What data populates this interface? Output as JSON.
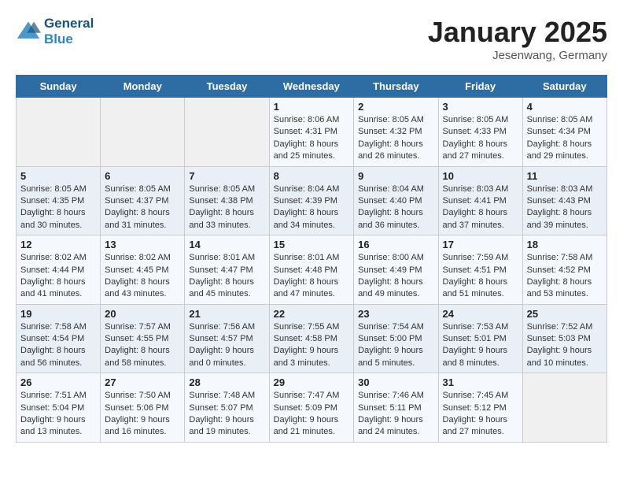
{
  "header": {
    "logo_line1": "General",
    "logo_line2": "Blue",
    "month": "January 2025",
    "location": "Jesenwang, Germany"
  },
  "columns": [
    "Sunday",
    "Monday",
    "Tuesday",
    "Wednesday",
    "Thursday",
    "Friday",
    "Saturday"
  ],
  "weeks": [
    [
      {
        "day": "",
        "info": ""
      },
      {
        "day": "",
        "info": ""
      },
      {
        "day": "",
        "info": ""
      },
      {
        "day": "1",
        "info": "Sunrise: 8:06 AM\nSunset: 4:31 PM\nDaylight: 8 hours and 25 minutes."
      },
      {
        "day": "2",
        "info": "Sunrise: 8:05 AM\nSunset: 4:32 PM\nDaylight: 8 hours and 26 minutes."
      },
      {
        "day": "3",
        "info": "Sunrise: 8:05 AM\nSunset: 4:33 PM\nDaylight: 8 hours and 27 minutes."
      },
      {
        "day": "4",
        "info": "Sunrise: 8:05 AM\nSunset: 4:34 PM\nDaylight: 8 hours and 29 minutes."
      }
    ],
    [
      {
        "day": "5",
        "info": "Sunrise: 8:05 AM\nSunset: 4:35 PM\nDaylight: 8 hours and 30 minutes."
      },
      {
        "day": "6",
        "info": "Sunrise: 8:05 AM\nSunset: 4:37 PM\nDaylight: 8 hours and 31 minutes."
      },
      {
        "day": "7",
        "info": "Sunrise: 8:05 AM\nSunset: 4:38 PM\nDaylight: 8 hours and 33 minutes."
      },
      {
        "day": "8",
        "info": "Sunrise: 8:04 AM\nSunset: 4:39 PM\nDaylight: 8 hours and 34 minutes."
      },
      {
        "day": "9",
        "info": "Sunrise: 8:04 AM\nSunset: 4:40 PM\nDaylight: 8 hours and 36 minutes."
      },
      {
        "day": "10",
        "info": "Sunrise: 8:03 AM\nSunset: 4:41 PM\nDaylight: 8 hours and 37 minutes."
      },
      {
        "day": "11",
        "info": "Sunrise: 8:03 AM\nSunset: 4:43 PM\nDaylight: 8 hours and 39 minutes."
      }
    ],
    [
      {
        "day": "12",
        "info": "Sunrise: 8:02 AM\nSunset: 4:44 PM\nDaylight: 8 hours and 41 minutes."
      },
      {
        "day": "13",
        "info": "Sunrise: 8:02 AM\nSunset: 4:45 PM\nDaylight: 8 hours and 43 minutes."
      },
      {
        "day": "14",
        "info": "Sunrise: 8:01 AM\nSunset: 4:47 PM\nDaylight: 8 hours and 45 minutes."
      },
      {
        "day": "15",
        "info": "Sunrise: 8:01 AM\nSunset: 4:48 PM\nDaylight: 8 hours and 47 minutes."
      },
      {
        "day": "16",
        "info": "Sunrise: 8:00 AM\nSunset: 4:49 PM\nDaylight: 8 hours and 49 minutes."
      },
      {
        "day": "17",
        "info": "Sunrise: 7:59 AM\nSunset: 4:51 PM\nDaylight: 8 hours and 51 minutes."
      },
      {
        "day": "18",
        "info": "Sunrise: 7:58 AM\nSunset: 4:52 PM\nDaylight: 8 hours and 53 minutes."
      }
    ],
    [
      {
        "day": "19",
        "info": "Sunrise: 7:58 AM\nSunset: 4:54 PM\nDaylight: 8 hours and 56 minutes."
      },
      {
        "day": "20",
        "info": "Sunrise: 7:57 AM\nSunset: 4:55 PM\nDaylight: 8 hours and 58 minutes."
      },
      {
        "day": "21",
        "info": "Sunrise: 7:56 AM\nSunset: 4:57 PM\nDaylight: 9 hours and 0 minutes."
      },
      {
        "day": "22",
        "info": "Sunrise: 7:55 AM\nSunset: 4:58 PM\nDaylight: 9 hours and 3 minutes."
      },
      {
        "day": "23",
        "info": "Sunrise: 7:54 AM\nSunset: 5:00 PM\nDaylight: 9 hours and 5 minutes."
      },
      {
        "day": "24",
        "info": "Sunrise: 7:53 AM\nSunset: 5:01 PM\nDaylight: 9 hours and 8 minutes."
      },
      {
        "day": "25",
        "info": "Sunrise: 7:52 AM\nSunset: 5:03 PM\nDaylight: 9 hours and 10 minutes."
      }
    ],
    [
      {
        "day": "26",
        "info": "Sunrise: 7:51 AM\nSunset: 5:04 PM\nDaylight: 9 hours and 13 minutes."
      },
      {
        "day": "27",
        "info": "Sunrise: 7:50 AM\nSunset: 5:06 PM\nDaylight: 9 hours and 16 minutes."
      },
      {
        "day": "28",
        "info": "Sunrise: 7:48 AM\nSunset: 5:07 PM\nDaylight: 9 hours and 19 minutes."
      },
      {
        "day": "29",
        "info": "Sunrise: 7:47 AM\nSunset: 5:09 PM\nDaylight: 9 hours and 21 minutes."
      },
      {
        "day": "30",
        "info": "Sunrise: 7:46 AM\nSunset: 5:11 PM\nDaylight: 9 hours and 24 minutes."
      },
      {
        "day": "31",
        "info": "Sunrise: 7:45 AM\nSunset: 5:12 PM\nDaylight: 9 hours and 27 minutes."
      },
      {
        "day": "",
        "info": ""
      }
    ]
  ]
}
